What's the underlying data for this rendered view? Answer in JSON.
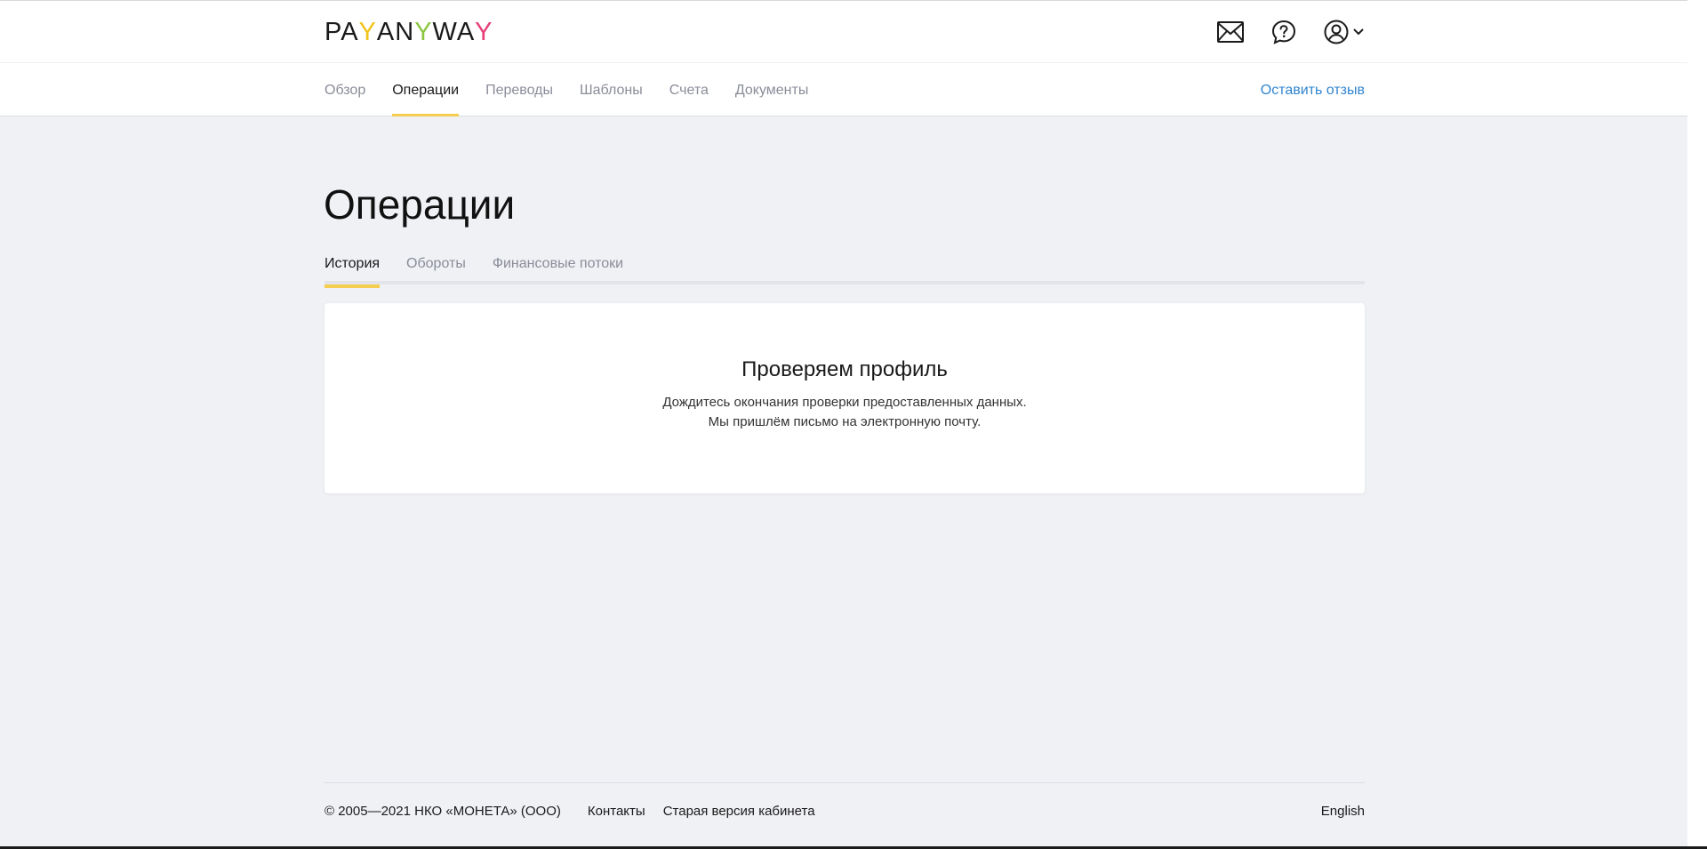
{
  "header": {
    "logo": {
      "parts": [
        "PA",
        "Y",
        "AN",
        "Y",
        "WA",
        "Y"
      ],
      "colors": [
        "#1a1a1a",
        "#f2c318",
        "#1a1a1a",
        "#8cc63f",
        "#1a1a1a",
        "#e63f78"
      ]
    },
    "icons": [
      "mail-icon",
      "help-icon",
      "user-icon",
      "chevron-down-icon"
    ],
    "nav": [
      {
        "label": "Обзор",
        "active": false
      },
      {
        "label": "Операции",
        "active": true
      },
      {
        "label": "Переводы",
        "active": false
      },
      {
        "label": "Шаблоны",
        "active": false
      },
      {
        "label": "Счета",
        "active": false
      },
      {
        "label": "Документы",
        "active": false
      }
    ],
    "feedback_label": "Оставить отзыв"
  },
  "main": {
    "title": "Операции",
    "subtabs": [
      {
        "label": "История",
        "active": true
      },
      {
        "label": "Обороты",
        "active": false
      },
      {
        "label": "Финансовые потоки",
        "active": false
      }
    ],
    "card": {
      "title": "Проверяем профиль",
      "line1": "Дождитесь окончания проверки предоставленных данных.",
      "line2": "Мы пришлём письмо на электронную почту."
    }
  },
  "footer": {
    "copyright": "© 2005—2021 НКО «МОНЕТА» (ООО)",
    "links": [
      "Контакты",
      "Старая версия кабинета"
    ],
    "language": "English"
  },
  "colors": {
    "accent": "#f5cd4f",
    "link": "#3085cf",
    "background": "#f0f1f5"
  }
}
